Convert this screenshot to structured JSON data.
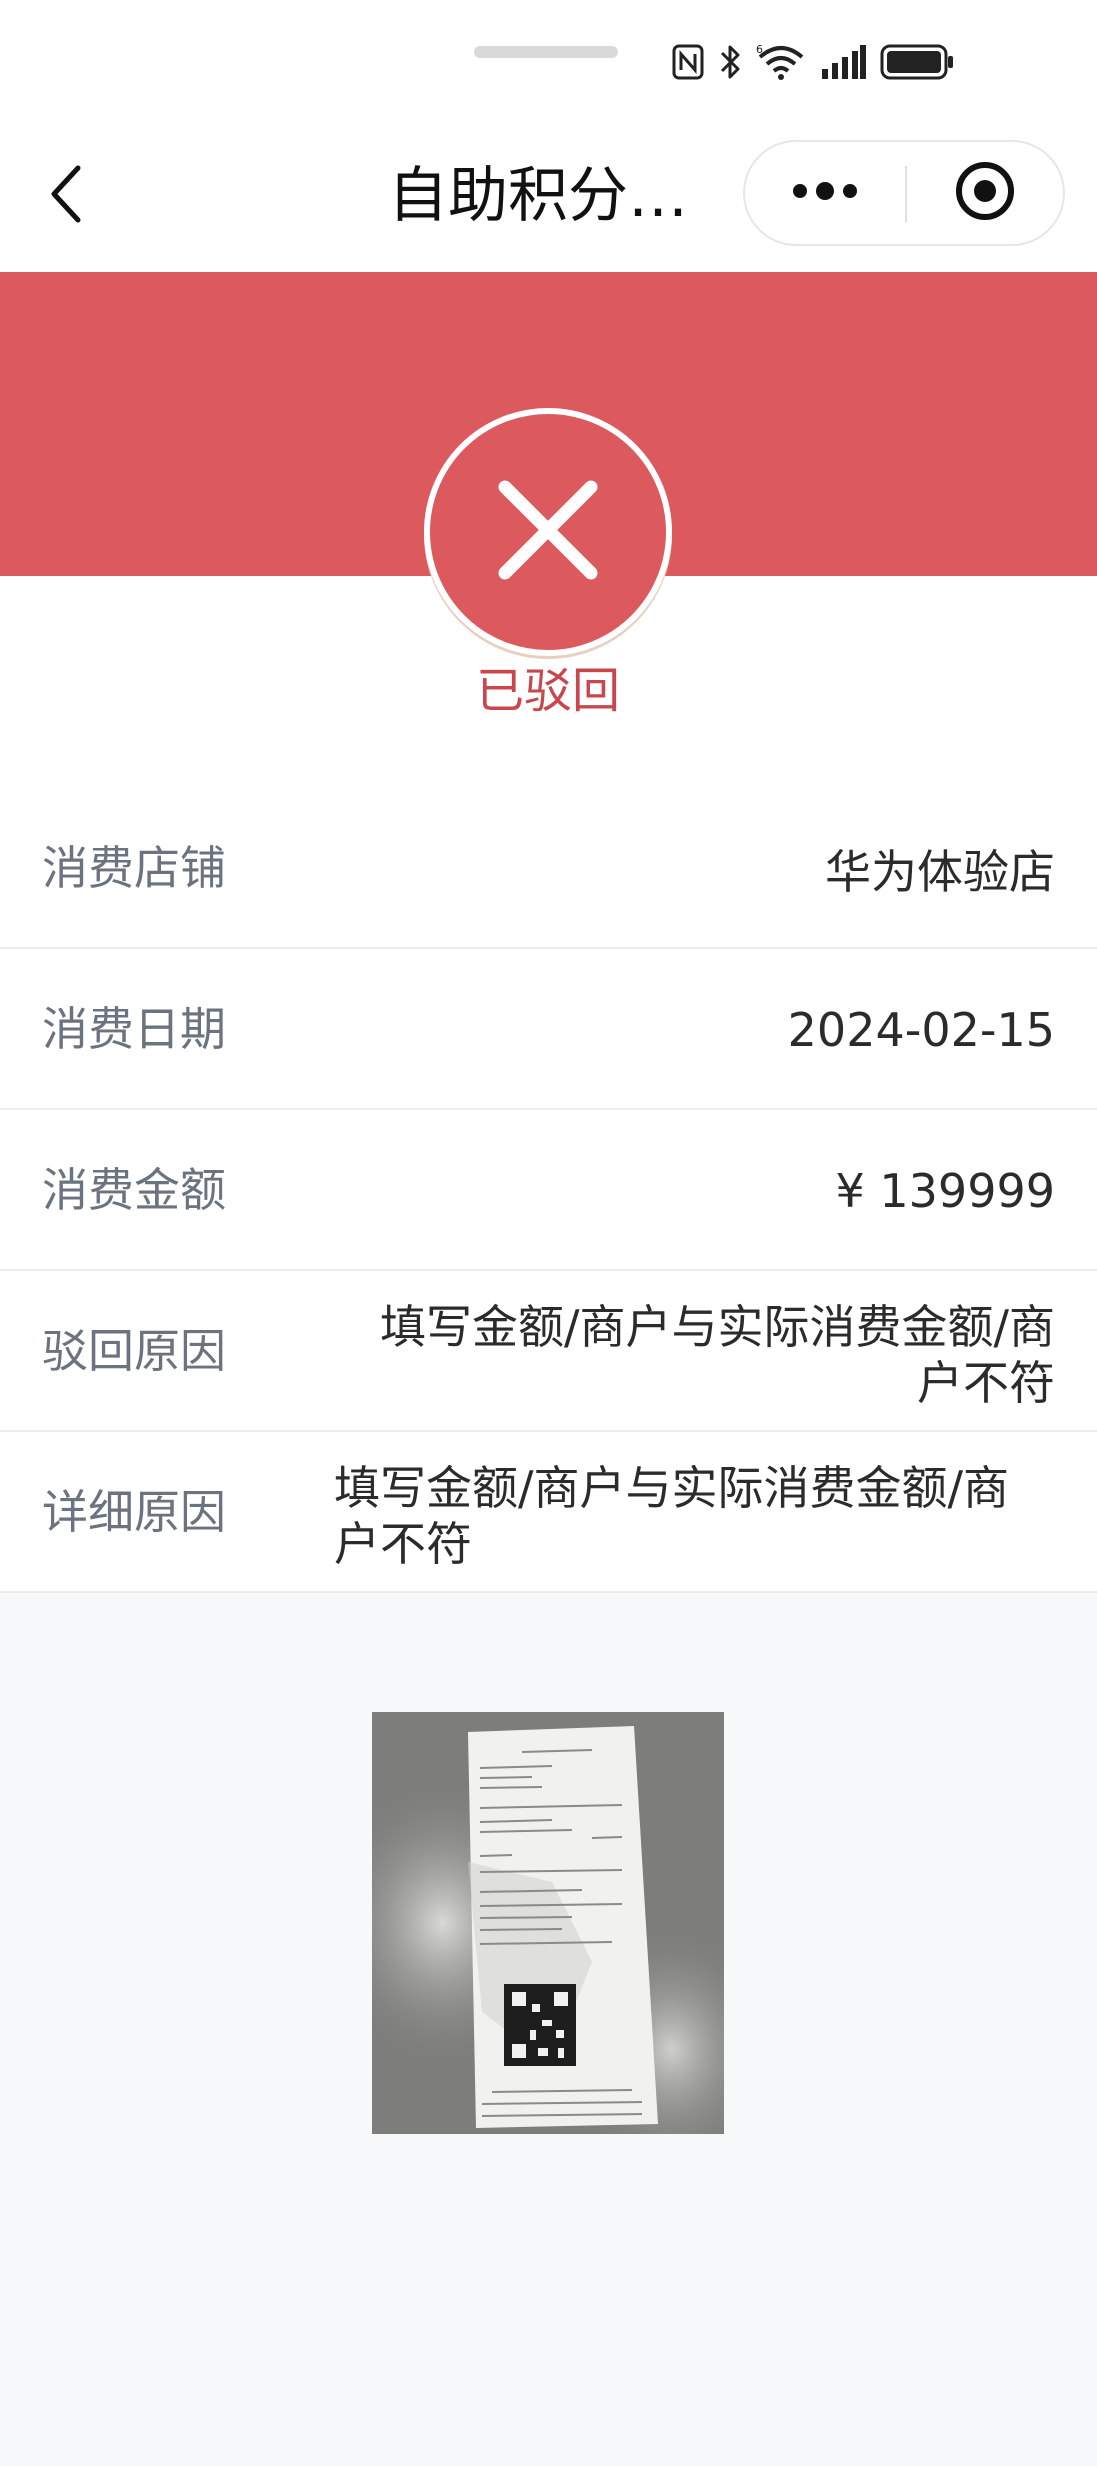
{
  "status_bar": {
    "icons": [
      "nfc-icon",
      "bluetooth-icon",
      "wifi-6-icon",
      "signal-icon",
      "battery-icon"
    ],
    "wifi_badge": "6"
  },
  "nav": {
    "title": "自助积分…",
    "back_icon": "chevron-left-icon",
    "more_icon": "more-dots-icon",
    "close_icon": "target-icon"
  },
  "colors": {
    "banner": "#dc5a5e",
    "status_text": "#c9474c"
  },
  "status": {
    "icon": "close-x-icon",
    "text": "已驳回"
  },
  "details": {
    "store": {
      "label": "消费店铺",
      "value": "华为体验店"
    },
    "date": {
      "label": "消费日期",
      "value": "2024-02-15"
    },
    "amount": {
      "label": "消费金额",
      "value": "¥ 139999"
    },
    "reject_reason": {
      "label": "驳回原因",
      "value": "填写金额/商户与实际消费金额/商户不符"
    },
    "detail_reason": {
      "label": "详细原因",
      "value": "填写金额/商户与实际消费金额/商户不符"
    }
  },
  "receipt": {
    "alt": "receipt-photo"
  }
}
